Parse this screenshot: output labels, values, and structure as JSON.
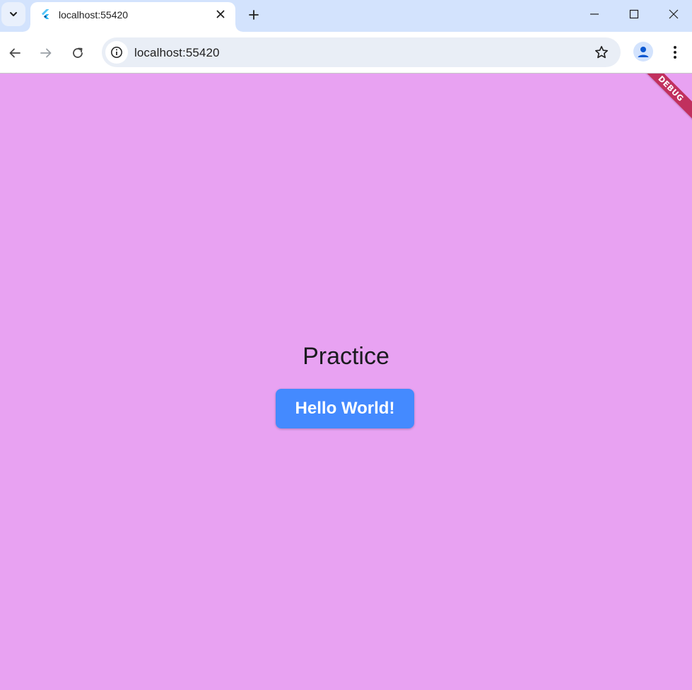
{
  "browser": {
    "tab": {
      "title": "localhost:55420"
    },
    "address": {
      "url": "localhost:55420"
    }
  },
  "app": {
    "title": "Practice",
    "button_label": "Hello World!",
    "debug_banner": "DEBUG",
    "colors": {
      "background": "#e8a2f2",
      "button": "#448aff",
      "button_text": "#ffffff",
      "banner": "#b00020"
    }
  },
  "icons": {
    "tab_search": "chevron-down-icon",
    "favicon": "flutter-icon",
    "tab_close": "close-icon",
    "new_tab": "plus-icon",
    "minimize": "minimize-icon",
    "maximize": "maximize-icon",
    "window_close": "close-icon",
    "back": "arrow-left-icon",
    "forward": "arrow-right-icon",
    "reload": "reload-icon",
    "site_info": "info-icon",
    "bookmark": "star-icon",
    "profile": "person-icon",
    "menu": "kebab-menu-icon"
  }
}
